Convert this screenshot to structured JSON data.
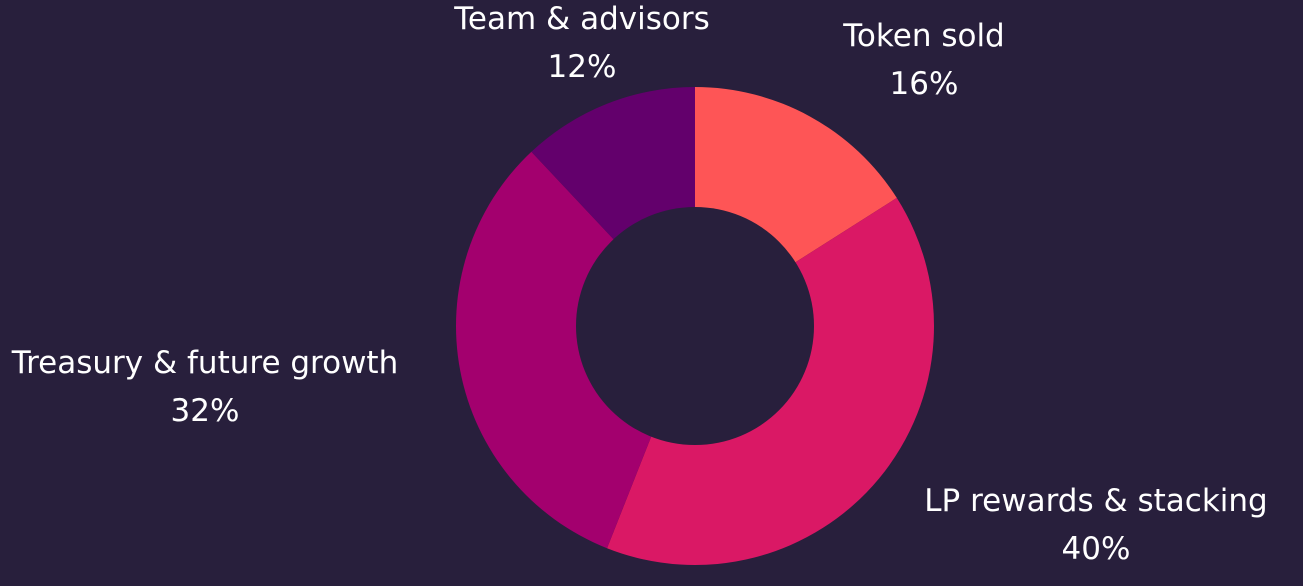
{
  "background": "#281f3c",
  "hole_color": "#281f3c",
  "chart_data": {
    "type": "pie",
    "donut": true,
    "grid": false,
    "legend": "none",
    "start_angle_deg": 0,
    "direction": "clockwise",
    "slices": [
      {
        "label": "Token sold",
        "value": 16,
        "value_label": "16%",
        "color": "#fe5556"
      },
      {
        "label": "LP rewards & stacking",
        "value": 40,
        "value_label": "40%",
        "color": "#da1865"
      },
      {
        "label": "Treasury & future growth",
        "value": 32,
        "value_label": "32%",
        "color": "#a3006e"
      },
      {
        "label": "Team & advisors",
        "value": 12,
        "value_label": "12%",
        "color": "#63006c"
      }
    ]
  }
}
